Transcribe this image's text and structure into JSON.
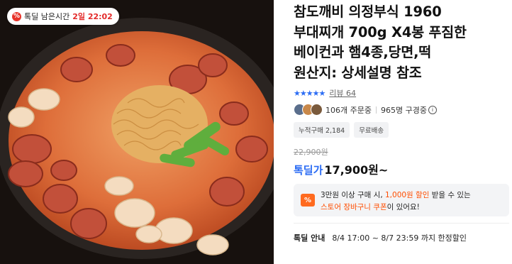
{
  "deal_badge": {
    "icon": "percent-icon",
    "label": "톡딜 남은시간",
    "time": "2일 22:02"
  },
  "product": {
    "title_lines": [
      "참도깨비 의정부식 1960",
      "부대찌개 700g X4봉 푸짐한",
      "베이컨과 햄4종,당면,떡",
      "원산지: 상세설명 참조"
    ],
    "review_label": "리뷰 64",
    "stars": "★★★★★",
    "order_count": "106개 주문중",
    "viewers": "965명 구경중",
    "tags": [
      "누적구매 2,184",
      "무료배송"
    ],
    "original_price": "22,900원",
    "price_label": "톡딜가",
    "price": "17,900원~"
  },
  "coupon": {
    "icon_text": "%",
    "line1_pre": "3만원 이상 구매 시,",
    "line1_highlight": "1,000원 할인",
    "line1_post": "받을 수 있는",
    "line2_highlight": "스토어 장바구니 쿠폰",
    "line2_post": "이 있어요!"
  },
  "deal_info": {
    "label": "톡딜 안내",
    "period": "8/4 17:00 ~ 8/7 23:59 까지 한정할인"
  },
  "colors": {
    "accent_blue": "#2b6cf4",
    "deal_red": "#e32a2a",
    "coupon_orange": "#ff4d00"
  }
}
